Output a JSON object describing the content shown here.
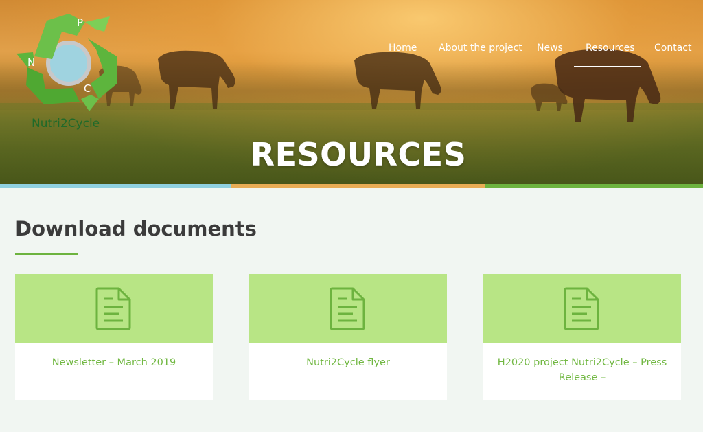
{
  "logo": {
    "letters": [
      "P",
      "N",
      "C"
    ],
    "text": "Nutri2Cycle"
  },
  "nav": {
    "items": [
      "Home",
      "About the project",
      "News",
      "Resources",
      "Contact"
    ],
    "active": "Resources"
  },
  "hero": {
    "title": "RESOURCES"
  },
  "section": {
    "title": "Download documents"
  },
  "cards": [
    {
      "icon": "document-icon",
      "label": "Newsletter – March 2019"
    },
    {
      "icon": "document-icon",
      "label": "Nutri2Cycle flyer"
    },
    {
      "icon": "document-icon",
      "label": "H2020 project Nutri2Cycle – Press Release –"
    }
  ],
  "colors": {
    "accent_green": "#6db33f",
    "card_top": "#b8e585",
    "bar_blue": "#8fd0e0",
    "bar_orange": "#e8ac55",
    "bar_green": "#6db33f"
  }
}
